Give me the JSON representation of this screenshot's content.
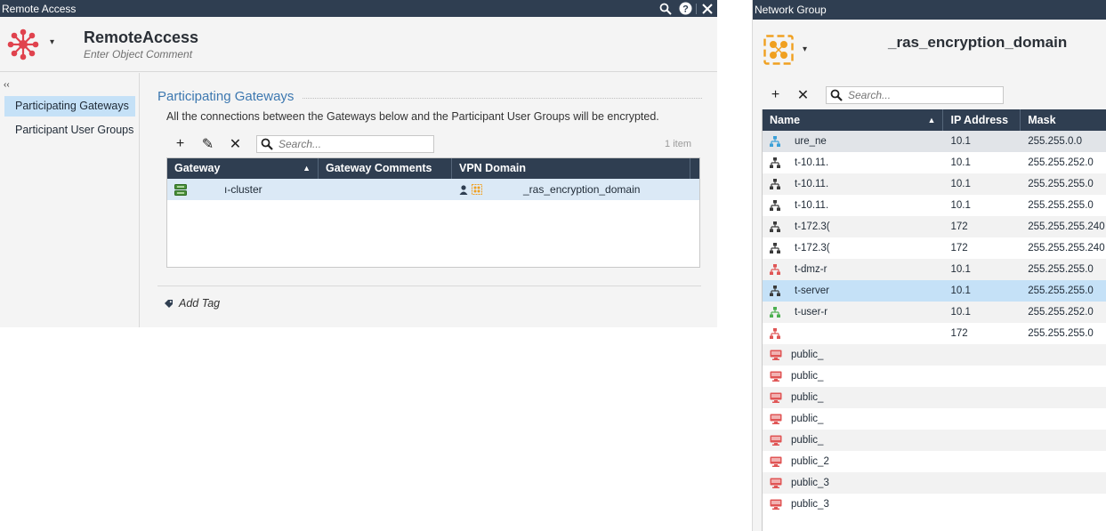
{
  "left_window": {
    "title": "Remote Access",
    "object": {
      "name": "RemoteAccess",
      "comment_placeholder": "Enter Object Comment",
      "icon": "remote-access-icon"
    },
    "nav": {
      "collapse_label": "‹‹",
      "items": [
        {
          "label": "Participating Gateways",
          "active": true
        },
        {
          "label": "Participant User Groups",
          "active": false
        }
      ]
    },
    "section": {
      "title": "Participating Gateways",
      "description": "All the connections between the Gateways below and the Participant User Groups will be encrypted."
    },
    "toolbar": {
      "add_label": "+",
      "edit_label": "✎",
      "remove_label": "✕",
      "search_placeholder": "Search...",
      "item_count": "1 item"
    },
    "grid": {
      "columns": [
        "Gateway",
        "Gateway Comments",
        "VPN Domain"
      ],
      "rows": [
        {
          "gateway": "ı-cluster",
          "comments": "",
          "vpn_domain": "_ras_encryption_domain"
        }
      ]
    },
    "add_tag_label": "Add Tag"
  },
  "right_window": {
    "title": "Network Group",
    "object": {
      "name": "_ras_encryption_domain",
      "icon": "network-group-icon"
    },
    "toolbar": {
      "add_label": "+",
      "remove_label": "✕",
      "search_placeholder": "Search..."
    },
    "grid": {
      "columns": [
        "Name",
        "IP Address",
        "Mask"
      ],
      "rows": [
        {
          "name": "ure_ne",
          "ip": "10.1",
          "mask": "255.255.0.0",
          "icon": "network-icon",
          "color": "#3aa0d8"
        },
        {
          "name": "t-10.11.",
          "ip": "10.1",
          "mask": "255.255.252.0",
          "icon": "network-icon",
          "color": "#3b3b3b"
        },
        {
          "name": "t-10.11.",
          "ip": "10.1",
          "mask": "255.255.255.0",
          "icon": "network-icon",
          "color": "#3b3b3b"
        },
        {
          "name": "t-10.11.",
          "ip": "10.1",
          "mask": "255.255.255.0",
          "icon": "network-icon",
          "color": "#3b3b3b"
        },
        {
          "name": "t-172.3(",
          "ip": "172",
          "mask": "255.255.255.240",
          "icon": "network-icon",
          "color": "#3b3b3b"
        },
        {
          "name": "t-172.3(",
          "ip": "172",
          "mask": "255.255.255.240",
          "icon": "network-icon",
          "color": "#3b3b3b"
        },
        {
          "name": "t-dmz-r",
          "ip": "10.1",
          "mask": "255.255.255.0",
          "icon": "network-icon",
          "color": "#e05555"
        },
        {
          "name": "t-server",
          "ip": "10.1",
          "mask": "255.255.255.0",
          "icon": "network-icon",
          "color": "#3b3b3b"
        },
        {
          "name": "t-user-r",
          "ip": "10.1",
          "mask": "255.255.252.0",
          "icon": "network-icon",
          "color": "#4caf50"
        },
        {
          "name": "",
          "ip": "172",
          "mask": "255.255.255.0",
          "icon": "network-icon",
          "color": "#e05555"
        },
        {
          "name": "public_",
          "ip": "",
          "mask": "",
          "icon": "host-icon",
          "color": "#e05555"
        },
        {
          "name": "public_",
          "ip": "",
          "mask": "",
          "icon": "host-icon",
          "color": "#e05555"
        },
        {
          "name": "public_",
          "ip": "",
          "mask": "",
          "icon": "host-icon",
          "color": "#e05555"
        },
        {
          "name": "public_",
          "ip": "",
          "mask": "",
          "icon": "host-icon",
          "color": "#e05555"
        },
        {
          "name": "public_",
          "ip": "",
          "mask": "",
          "icon": "host-icon",
          "color": "#e05555"
        },
        {
          "name": "public_2",
          "ip": "",
          "mask": "",
          "icon": "host-icon",
          "color": "#e05555"
        },
        {
          "name": "public_3",
          "ip": "",
          "mask": "",
          "icon": "host-icon",
          "color": "#e05555"
        },
        {
          "name": "public_3",
          "ip": "",
          "mask": "",
          "icon": "host-icon",
          "color": "#e05555"
        }
      ],
      "selected_row": 7
    }
  },
  "colors": {
    "titlebar": "#2f3e51",
    "accent": "#3d78b0",
    "selection": "#c5e1f7",
    "brand_red": "#e0434e",
    "group_orange": "#f0a020"
  }
}
